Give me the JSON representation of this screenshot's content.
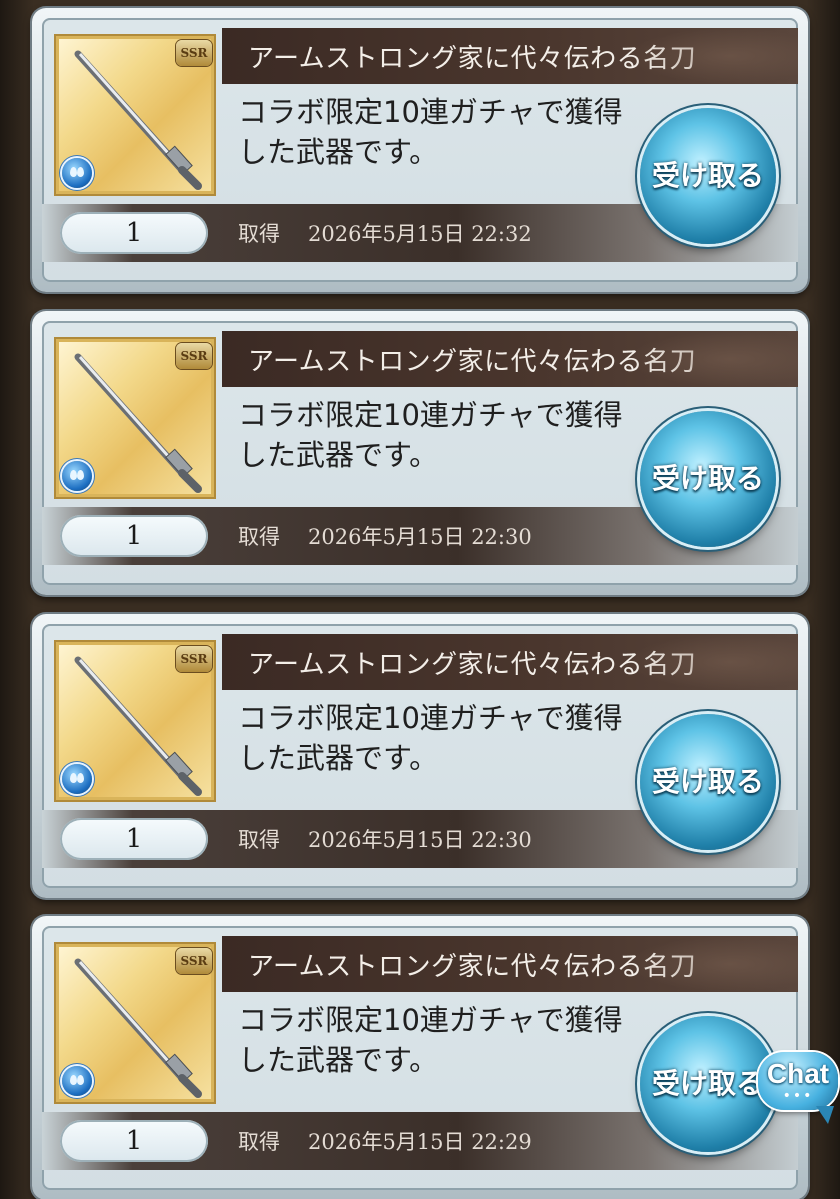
{
  "items": [
    {
      "name": "アームストロング家に代々伝わる名刀",
      "description": "コラボ限定10連ガチャで獲得した武器です。",
      "rarity": "SSR",
      "quantity": "1",
      "acquired_label": "取得",
      "acquired_date": "2026年5月15日 22:32",
      "receive_label": "受け取る"
    },
    {
      "name": "アームストロング家に代々伝わる名刀",
      "description": "コラボ限定10連ガチャで獲得した武器です。",
      "rarity": "SSR",
      "quantity": "1",
      "acquired_label": "取得",
      "acquired_date": "2026年5月15日 22:30",
      "receive_label": "受け取る"
    },
    {
      "name": "アームストロング家に代々伝わる名刀",
      "description": "コラボ限定10連ガチャで獲得した武器です。",
      "rarity": "SSR",
      "quantity": "1",
      "acquired_label": "取得",
      "acquired_date": "2026年5月15日 22:30",
      "receive_label": "受け取る"
    },
    {
      "name": "アームストロング家に代々伝わる名刀",
      "description": "コラボ限定10連ガチャで獲得した武器です。",
      "rarity": "SSR",
      "quantity": "1",
      "acquired_label": "取得",
      "acquired_date": "2026年5月15日 22:29",
      "receive_label": "受け取る"
    }
  ],
  "chat": {
    "label": "Chat"
  }
}
